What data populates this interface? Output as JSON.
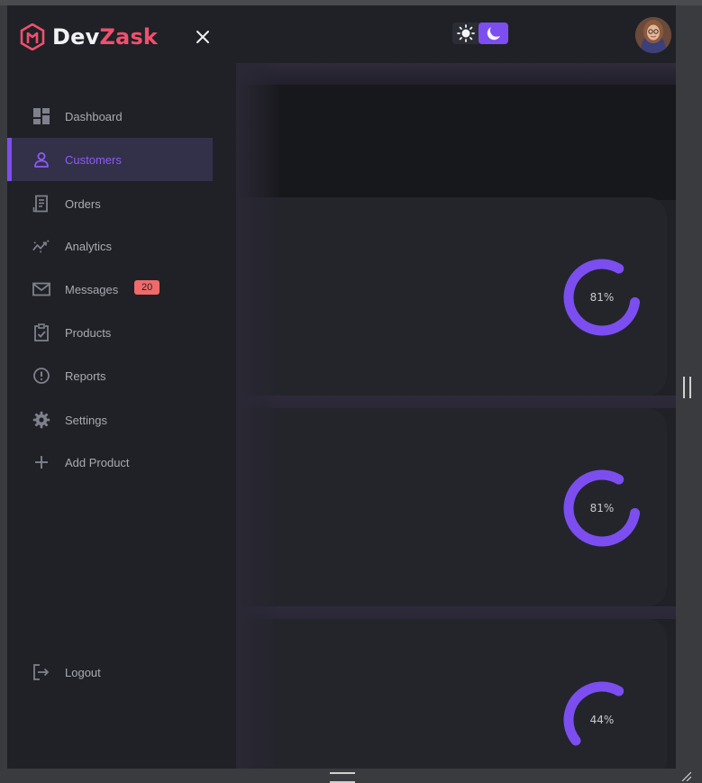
{
  "brand": {
    "part1": "Dev",
    "part2": "Zask"
  },
  "sidebar": {
    "items": [
      {
        "label": "Dashboard",
        "icon": "grid-icon"
      },
      {
        "label": "Customers",
        "icon": "person-icon",
        "active": true
      },
      {
        "label": "Orders",
        "icon": "receipt-icon"
      },
      {
        "label": "Analytics",
        "icon": "analytics-icon"
      },
      {
        "label": "Messages",
        "icon": "mail-icon",
        "badge": "20"
      },
      {
        "label": "Products",
        "icon": "clipboard-check-icon"
      },
      {
        "label": "Reports",
        "icon": "alert-circle-icon"
      },
      {
        "label": "Settings",
        "icon": "gear-icon"
      },
      {
        "label": "Add Product",
        "icon": "plus-icon"
      }
    ],
    "logout_label": "Logout"
  },
  "stats": [
    {
      "percent_label": "81%",
      "progress": 0.81
    },
    {
      "percent_label": "81%",
      "progress": 0.81
    },
    {
      "percent_label": "44%",
      "progress": 0.44
    }
  ],
  "colors": {
    "accent": "#7c4ef0",
    "brand_red": "#f0506e",
    "badge": "#f16a6a",
    "background": "#1f2126"
  }
}
